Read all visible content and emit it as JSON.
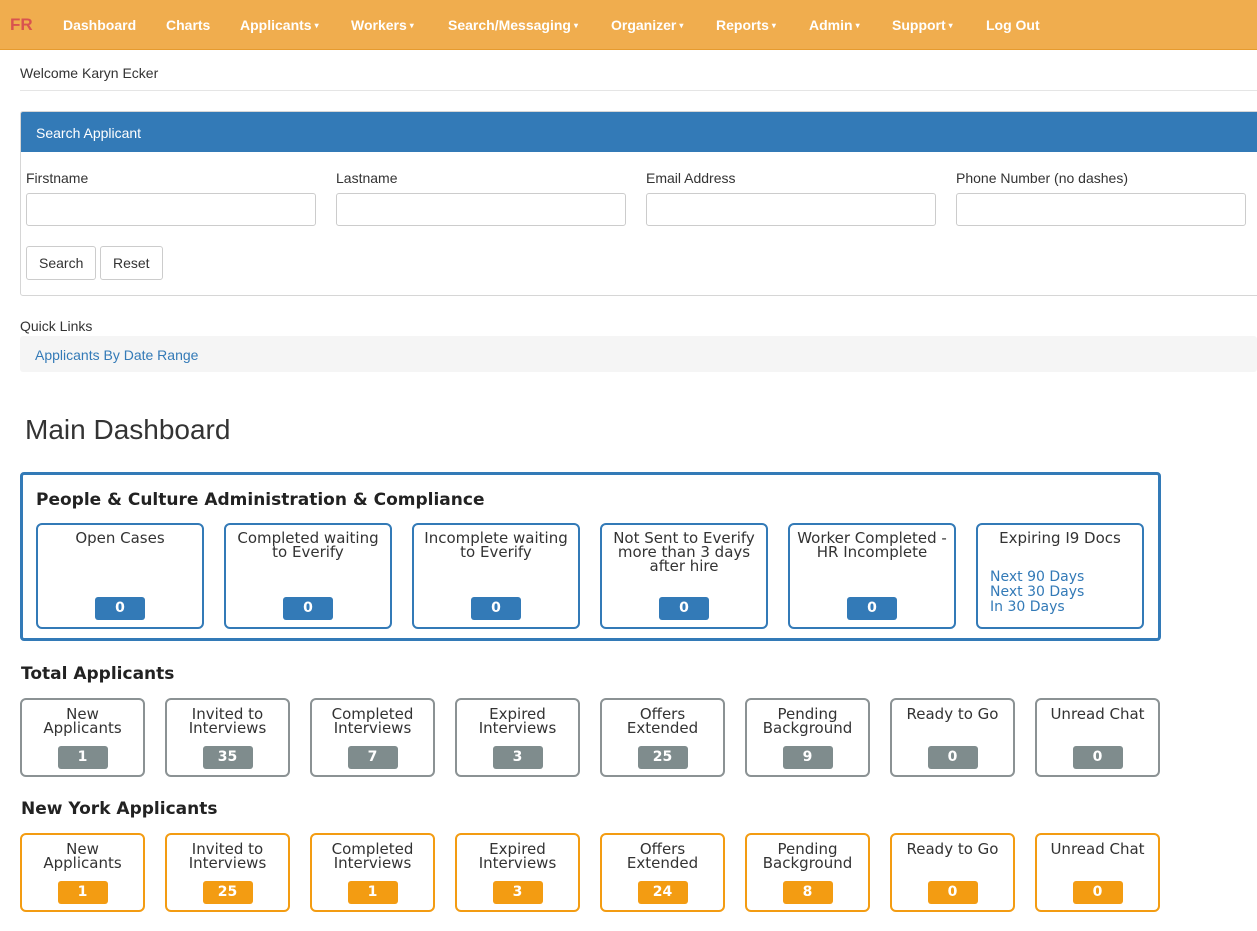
{
  "nav": {
    "brand": "FR",
    "items": [
      {
        "label": "Dashboard"
      },
      {
        "label": "Charts"
      },
      {
        "label": "Applicants",
        "caret": "▾"
      },
      {
        "label": "Workers",
        "caret": "▾"
      },
      {
        "label": "Search/Messaging",
        "caret": "▾"
      },
      {
        "label": "Organizer",
        "caret": "▾"
      },
      {
        "label": "Reports",
        "caret": "▾"
      },
      {
        "label": "Admin",
        "caret": "▾"
      },
      {
        "label": "Support",
        "caret": "▾"
      },
      {
        "label": "Log Out"
      }
    ]
  },
  "welcome": "Welcome Karyn Ecker",
  "search": {
    "title": "Search Applicant",
    "fields": [
      {
        "label": "Firstname",
        "value": "",
        "placeholder": ""
      },
      {
        "label": "Lastname",
        "value": "",
        "placeholder": ""
      },
      {
        "label": "Email Address",
        "value": "",
        "placeholder": ""
      },
      {
        "label": "Phone Number (no dashes)",
        "value": "",
        "placeholder": ""
      }
    ],
    "search_label": "Search",
    "reset_label": "Reset"
  },
  "quick_links": {
    "label": "Quick Links",
    "link": "Applicants By Date Range"
  },
  "main_title": "Main Dashboard",
  "compliance": {
    "title": "People & Culture Administration & Compliance",
    "cards": [
      {
        "label": "Open Cases",
        "count": "0"
      },
      {
        "label": "Completed waiting to Everify",
        "count": "0"
      },
      {
        "label": "Incomplete waiting to Everify",
        "count": "0"
      },
      {
        "label": "Not Sent to Everify more than 3 days after hire",
        "count": "0"
      },
      {
        "label": "Worker Completed - HR Incomplete",
        "count": "0"
      }
    ],
    "expiring": {
      "label": "Expiring I9 Docs",
      "links": [
        "Next 90 Days",
        "Next 30 Days",
        "In 30 Days"
      ]
    }
  },
  "total_applicants": {
    "title": "Total Applicants",
    "cards": [
      {
        "label": "New Applicants",
        "count": "1"
      },
      {
        "label": "Invited to Interviews",
        "count": "35"
      },
      {
        "label": "Completed Interviews",
        "count": "7"
      },
      {
        "label": "Expired Interviews",
        "count": "3"
      },
      {
        "label": "Offers Extended",
        "count": "25"
      },
      {
        "label": "Pending Background",
        "count": "9"
      },
      {
        "label": "Ready to Go",
        "count": "0"
      },
      {
        "label": "Unread Chat",
        "count": "0"
      }
    ]
  },
  "ny_applicants": {
    "title": "New York Applicants",
    "cards": [
      {
        "label": "New Applicants",
        "count": "1"
      },
      {
        "label": "Invited to Interviews",
        "count": "25"
      },
      {
        "label": "Completed Interviews",
        "count": "1"
      },
      {
        "label": "Expired Interviews",
        "count": "3"
      },
      {
        "label": "Offers Extended",
        "count": "24"
      },
      {
        "label": "Pending Background",
        "count": "8"
      },
      {
        "label": "Ready to Go",
        "count": "0"
      },
      {
        "label": "Unread Chat",
        "count": "0"
      }
    ]
  },
  "colors": {
    "navbar": "#f0ad4e",
    "brand": "#d9534f",
    "primary": "#337ab7",
    "gray_badge": "#7f8c8d",
    "orange_badge": "#f39c12"
  }
}
